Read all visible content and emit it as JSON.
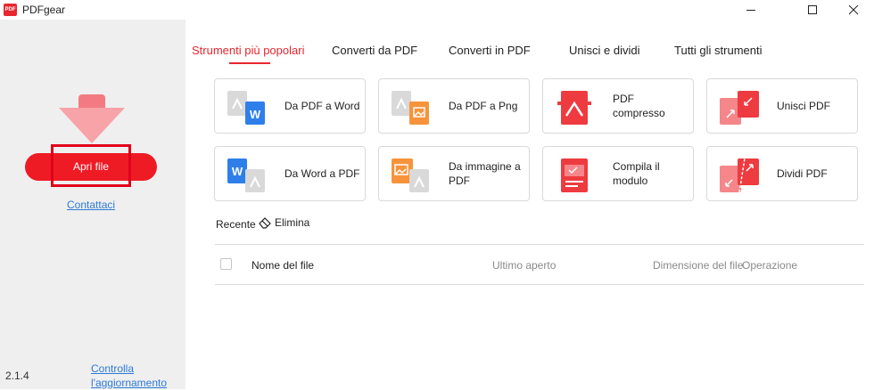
{
  "window": {
    "title": "PDFgear",
    "icon_text": "PDF"
  },
  "sidebar": {
    "open_button": "Apri file",
    "contact": "Contattaci",
    "version": "2.1.4",
    "update_line1": "Controlla",
    "update_line2": "l'aggiornamento"
  },
  "tabs": [
    {
      "label": "Strumenti più popolari",
      "active": true
    },
    {
      "label": "Converti da PDF"
    },
    {
      "label": "Converti in PDF"
    },
    {
      "label": "Unisci e dividi"
    },
    {
      "label": "Tutti gli strumenti"
    }
  ],
  "tools": [
    {
      "label": "Da PDF a Word",
      "icon": "pdf-to-word-icon"
    },
    {
      "label": "Da PDF a Png",
      "icon": "pdf-to-png-icon"
    },
    {
      "label": "PDF compresso",
      "icon": "compress-pdf-icon"
    },
    {
      "label": "Unisci PDF",
      "icon": "merge-pdf-icon"
    },
    {
      "label": "Da Word a PDF",
      "icon": "word-to-pdf-icon"
    },
    {
      "label": "Da immagine a PDF",
      "icon": "image-to-pdf-icon"
    },
    {
      "label": "Compila il modulo",
      "icon": "fill-form-icon"
    },
    {
      "label": "Dividi PDF",
      "icon": "split-pdf-icon"
    }
  ],
  "recent": {
    "title": "Recente",
    "delete": "Elimina",
    "columns": [
      "Nome del file",
      "Ultimo aperto",
      "Dimensione del file",
      "Operazione"
    ]
  },
  "colors": {
    "accent": "#e8262e",
    "open_button": "#ee1b24",
    "link": "#2d7ad8",
    "sidebar_bg": "#efefef"
  }
}
